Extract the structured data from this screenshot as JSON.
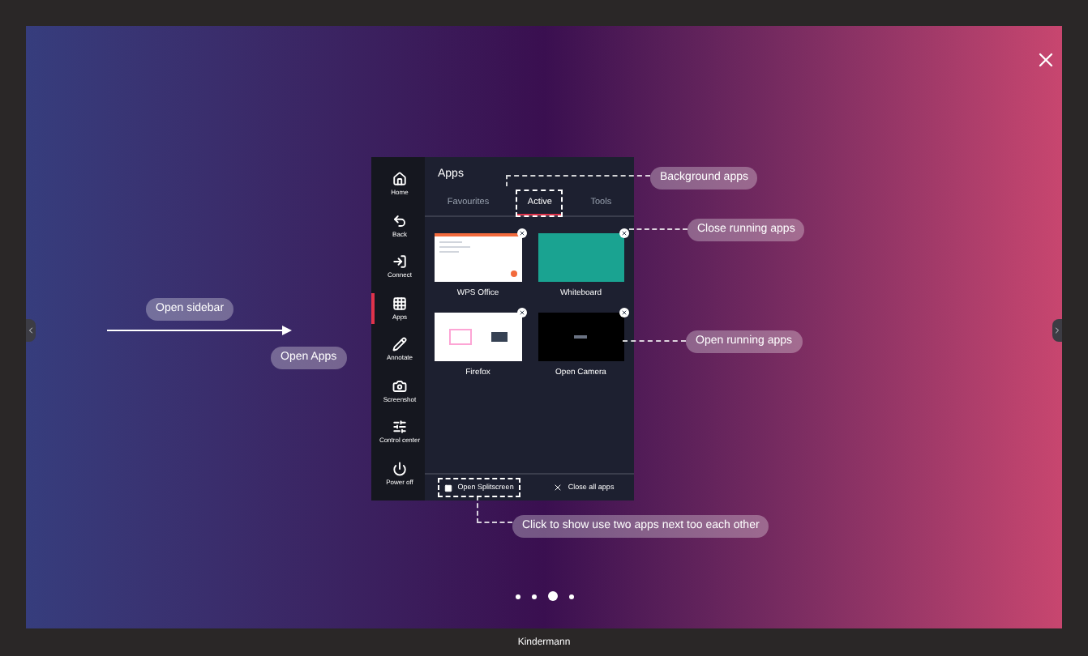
{
  "apps_panel": {
    "sidebar": [
      {
        "label": "Home",
        "selected": false
      },
      {
        "label": "Back",
        "selected": false
      },
      {
        "label": "Connect",
        "selected": false
      },
      {
        "label": "Apps",
        "selected": true
      },
      {
        "label": "Annotate",
        "selected": false
      },
      {
        "label": "Screenshot",
        "selected": false
      },
      {
        "label": "Control center",
        "selected": false
      },
      {
        "label": "Power off",
        "selected": false
      }
    ],
    "title": "Apps",
    "tabs": [
      {
        "label": "Favourites",
        "selected": false,
        "outlined": false
      },
      {
        "label": "Active",
        "selected": true,
        "outlined": true
      },
      {
        "label": "Tools",
        "selected": false,
        "outlined": false
      }
    ],
    "apps": [
      {
        "name": "WPS Office",
        "kind": "document"
      },
      {
        "name": "Whiteboard",
        "kind": "whiteboard"
      },
      {
        "name": "Firefox",
        "kind": "browser"
      },
      {
        "name": "Open Camera",
        "kind": "camera"
      }
    ],
    "buttons": [
      {
        "label": "Open Splitscreen",
        "kind": "splitscreen",
        "outlined": true
      },
      {
        "label": "Close all apps",
        "kind": "close",
        "outlined": false
      }
    ]
  },
  "annotations": [
    {
      "text": "Background apps"
    },
    {
      "text": "Close running apps"
    },
    {
      "text": "Open running apps"
    },
    {
      "text": "Open sidebar"
    },
    {
      "text": "Open Apps"
    },
    {
      "text": "Click to show use two apps next too each other"
    }
  ],
  "page_dots": [
    {
      "selected": false
    },
    {
      "selected": false
    },
    {
      "selected": true
    },
    {
      "selected": false
    }
  ],
  "brand": "Kindermann"
}
